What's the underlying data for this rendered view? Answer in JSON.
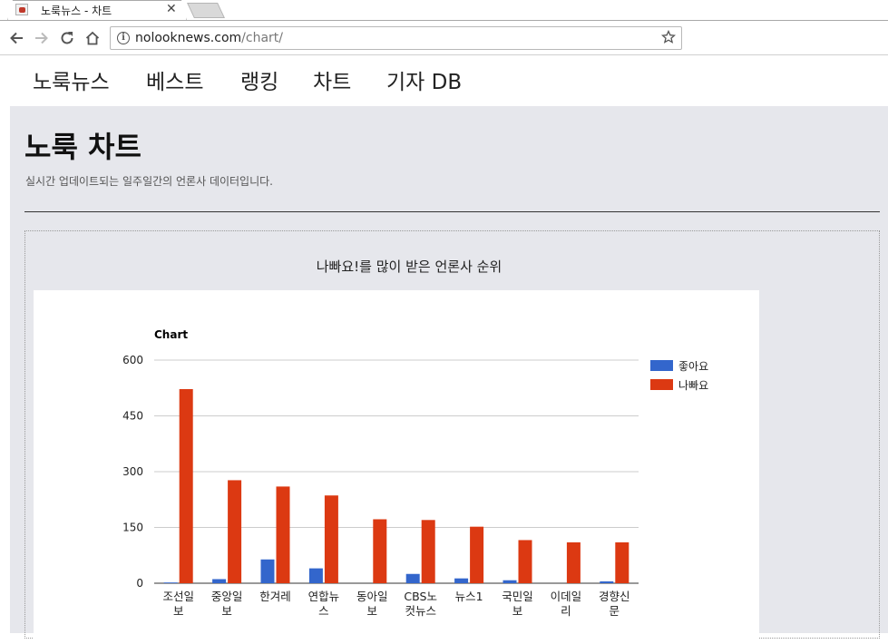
{
  "browser": {
    "tab_title": "노룩뉴스 - 차트",
    "url_host": "nolooknews.com",
    "url_path": "/chart/"
  },
  "nav": {
    "items": [
      "노룩뉴스",
      "베스트",
      "랭킹",
      "차트",
      "기자 DB"
    ]
  },
  "page": {
    "title": "노룩 차트",
    "subtitle": "실시간 업데이트되는 일주일간의 언론사 데이터입니다."
  },
  "chart_heading": "나빠요!를 많이 받은 언론사 순위",
  "colors": {
    "like": "#3366cc",
    "dislike": "#dc3912",
    "background": "#e6e7ec"
  },
  "chart_data": {
    "type": "bar",
    "title": "Chart",
    "categories": [
      "조선일보",
      "중앙일보",
      "한겨레",
      "연합뉴스",
      "동아일보",
      "CBS노컷뉴스",
      "뉴스1",
      "국민일보",
      "이데일리",
      "경향신문"
    ],
    "category_lines": [
      [
        "조선일",
        "보"
      ],
      [
        "중앙일",
        "보"
      ],
      [
        "한겨레"
      ],
      [
        "연합뉴",
        "스"
      ],
      [
        "동아일",
        "보"
      ],
      [
        "CBS노",
        "컷뉴스"
      ],
      [
        "뉴스1"
      ],
      [
        "국민일",
        "보"
      ],
      [
        "이데일",
        "리"
      ],
      [
        "경향신",
        "문"
      ]
    ],
    "series": [
      {
        "name": "좋아요",
        "values": [
          2,
          11,
          64,
          40,
          0,
          25,
          13,
          8,
          0,
          5
        ]
      },
      {
        "name": "나빠요",
        "values": [
          522,
          277,
          260,
          236,
          172,
          170,
          152,
          116,
          110,
          110
        ]
      }
    ],
    "ylim": [
      0,
      600
    ],
    "yticks": [
      0,
      150,
      300,
      450,
      600
    ],
    "legend": "right",
    "grid": true
  }
}
